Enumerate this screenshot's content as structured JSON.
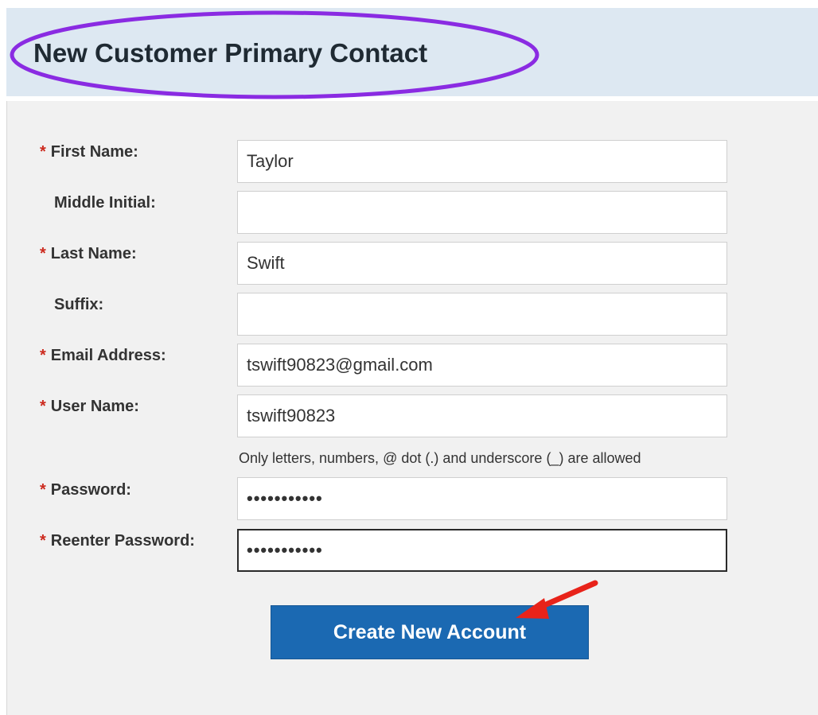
{
  "header": {
    "title": "New Customer Primary Contact"
  },
  "form": {
    "required_marker": "*",
    "fields": [
      {
        "label": "First Name:",
        "value": "Taylor",
        "required": true
      },
      {
        "label": "Middle Initial:",
        "value": "",
        "required": false
      },
      {
        "label": "Last Name:",
        "value": "Swift",
        "required": true
      },
      {
        "label": "Suffix:",
        "value": "",
        "required": false
      },
      {
        "label": "Email Address:",
        "value": "tswift90823@gmail.com",
        "required": true
      },
      {
        "label": "User Name:",
        "value": "tswift90823",
        "required": true
      },
      {
        "label": "Password:",
        "value": "•••••••••••",
        "required": true
      },
      {
        "label": "Reenter Password:",
        "value": "•••••••••••",
        "required": true
      }
    ],
    "username_hint": "Only letters, numbers, @ dot (.) and underscore (_) are allowed",
    "submit_label": "Create New Account"
  },
  "colors": {
    "header_bg": "#dde8f2",
    "panel_bg": "#f1f1f1",
    "required_marker": "#cc2a1e",
    "button_bg": "#1b69b2",
    "annotation_ellipse": "#8a2be2",
    "annotation_arrow": "#e8231a"
  },
  "annotations": [
    "ellipse-highlight",
    "arrow-pointer"
  ]
}
